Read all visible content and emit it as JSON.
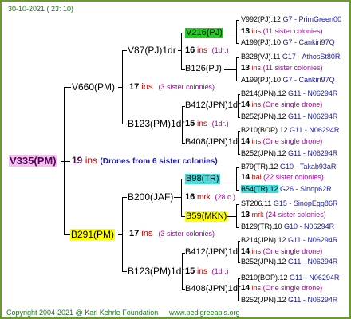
{
  "header": {
    "date": "30-10-2021 ( 23: 10)"
  },
  "footer": {
    "copyright": "Copyright 2004-2021 @ Karl Kehrle Foundation",
    "site": "www.pedigreeapis.org"
  },
  "root": {
    "name": "V335(PM)",
    "num": "19",
    "ins": "ins",
    "desc": "(Drones from 6 sister colonies)"
  },
  "gen1": [
    {
      "name": "V660(PM)",
      "num": "17",
      "ins": "ins",
      "desc": "(3 sister colonies)"
    },
    {
      "name": "B291(PM)",
      "num": "17",
      "ins": "ins",
      "desc": "(3 sister colonies)"
    }
  ],
  "gen2": [
    {
      "name": "V87(PJ)1dr",
      "num": "16",
      "ins": "ins",
      "desc": "(1dr.)"
    },
    {
      "name": "B123(PM)1dr",
      "num": "15",
      "ins": "ins",
      "desc": "(1dr.)"
    },
    {
      "name": "B200(JAF)",
      "num": "16",
      "ins": "mrk",
      "desc": "(28 c.)"
    },
    {
      "name": "B123(PM)1dr",
      "num": "15",
      "ins": "ins",
      "desc": "(1dr.)"
    }
  ],
  "gen3": [
    {
      "name": "V216(PJ)",
      "num": "13",
      "ins": "ins",
      "desc": "(11 sister colonies)"
    },
    {
      "name": "B126(PJ)",
      "num": "13",
      "ins": "ins",
      "desc": "(11 sister colonies)"
    },
    {
      "name": "B412(JPN)1dr",
      "num": "14",
      "ins": "ins",
      "desc": "(One single drone)"
    },
    {
      "name": "B408(JPN)1dr",
      "num": "14",
      "ins": "ins",
      "desc": "(One single drone)"
    },
    {
      "name": "B98(TR)",
      "num": "14",
      "ins": "bal",
      "desc": "(22 sister colonies)"
    },
    {
      "name": "B59(MKN)",
      "num": "13",
      "ins": "mrk",
      "desc": "(24 sister colonies)"
    },
    {
      "name": "B412(JPN)1dr",
      "num": "14",
      "ins": "ins",
      "desc": "(One single drone)"
    },
    {
      "name": "B408(JPN)1dr",
      "num": "14",
      "ins": "ins",
      "desc": "(One single drone)"
    }
  ],
  "gen4": [
    {
      "name": "V992(PJ).12",
      "code": "G7 - PrimGreen00"
    },
    {
      "name": "A199(PJ).10",
      "code": "G7 - Cankiri97Q"
    },
    {
      "name": "B328(VJ).11",
      "code": "G17 - AthosSt80R"
    },
    {
      "name": "A199(PJ).10",
      "code": "G7 - Cankiri97Q"
    },
    {
      "name": "B214(JPN).12",
      "code": "G11 - N06294R"
    },
    {
      "name": "B252(JPN).12",
      "code": "G11 - N06294R"
    },
    {
      "name": "B210(BOP).12",
      "code": "G11 - N06294R"
    },
    {
      "name": "B252(JPN).12",
      "code": "G11 - N06294R"
    },
    {
      "name": "B79(TR).12",
      "code": "G10 - Takab93aR"
    },
    {
      "name": "B54(TR).12",
      "code": "G26 - Sinop62R"
    },
    {
      "name": "ST206.11",
      "code": "G15 - SinopEgg86R"
    },
    {
      "name": "B129(TR).10",
      "code": "G10 - N06294R"
    },
    {
      "name": "B214(JPN).12",
      "code": "G11 - N06294R"
    },
    {
      "name": "B252(JPN).12",
      "code": "G11 - N06294R"
    },
    {
      "name": "B210(BOP).12",
      "code": "G11 - N06294R"
    },
    {
      "name": "B252(JPN).12",
      "code": "G11 - N06294R"
    }
  ],
  "colors": {
    "border": "#6a9a2a",
    "green_bg": "#22cc22",
    "yellow_bg": "#ffff00",
    "cyan_bg": "#44dddd",
    "root_bg": "#f0c0f0"
  }
}
